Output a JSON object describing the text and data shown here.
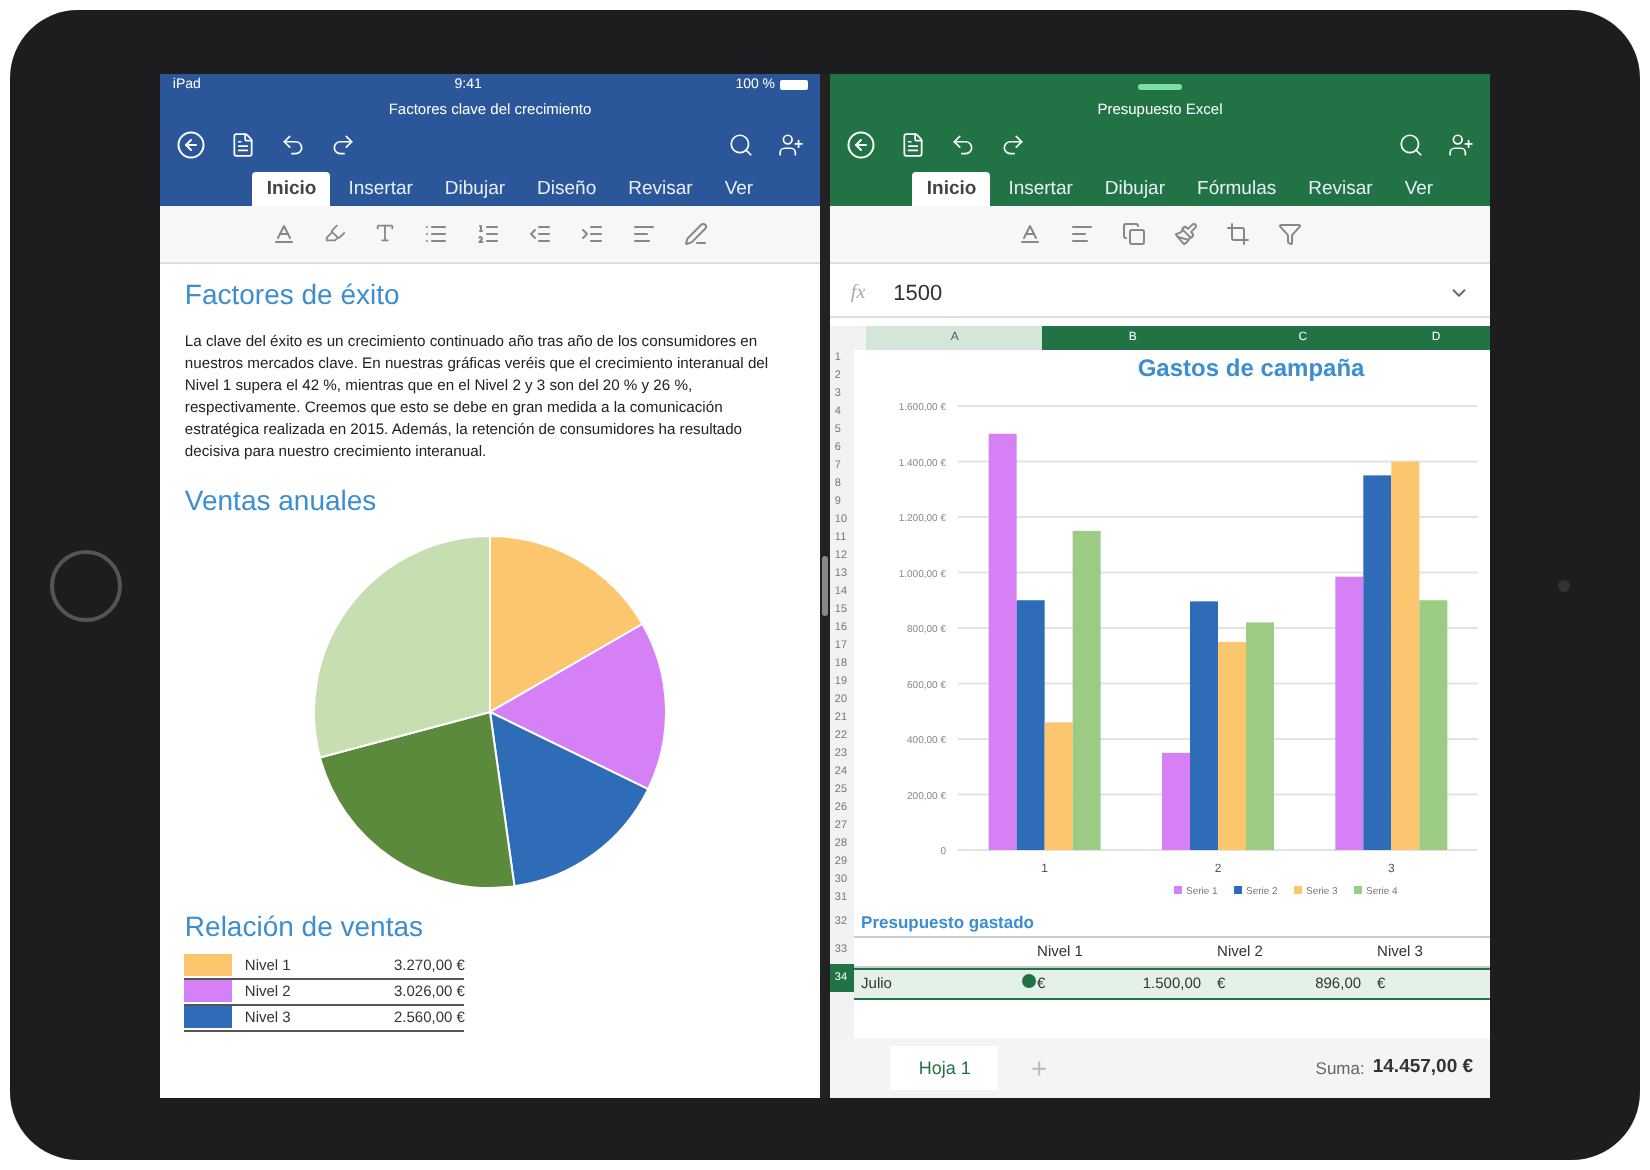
{
  "word": {
    "status": {
      "device": "iPad",
      "time": "9:41",
      "battery": "100 %"
    },
    "title": "Factores clave del crecimiento",
    "tabs": [
      {
        "label": "Inicio",
        "selected": true
      },
      {
        "label": "Insertar",
        "selected": false
      },
      {
        "label": "Dibujar",
        "selected": false
      },
      {
        "label": "Diseño",
        "selected": false
      },
      {
        "label": "Revisar",
        "selected": false
      },
      {
        "label": "Ver",
        "selected": false
      }
    ],
    "heading": "Factores de éxito",
    "paragraph": "La clave del éxito es un crecimiento continuado año tras año de los consumidores en nuestros mercados clave. En nuestras gráficas veréis que el crecimiento interanual del Nivel 1 supera el 42 %, mientras que en el Nivel 2 y 3 son del 20 % y 26 %, respectivamente. Creemos que esto se debe en gran medida a la comunicación estratégica realizada en 2015. Además, la retención de consumidores ha resultado decisiva para nuestro crecimiento interanual.",
    "chart_heading": "Ventas anuales",
    "table_heading": "Relación de ventas",
    "sales": [
      {
        "label": "Nivel 1",
        "value": "3.270,00 €",
        "color": "#fcc66e"
      },
      {
        "label": "Nivel 2",
        "value": "3.026,00 €",
        "color": "#d580f5"
      },
      {
        "label": "Nivel 3",
        "value": "2.560,00 €",
        "color": "#2e6cb8"
      }
    ]
  },
  "excel": {
    "title": "Presupuesto Excel",
    "tabs": [
      {
        "label": "Inicio",
        "selected": true
      },
      {
        "label": "Insertar",
        "selected": false
      },
      {
        "label": "Dibujar",
        "selected": false
      },
      {
        "label": "Fórmulas",
        "selected": false
      },
      {
        "label": "Revisar",
        "selected": false
      },
      {
        "label": "Ver",
        "selected": false
      }
    ],
    "formula_label": "fx",
    "formula": "1500",
    "columns": [
      {
        "label": "A",
        "selected": false
      },
      {
        "label": "B",
        "selected": true
      },
      {
        "label": "C",
        "selected": true
      },
      {
        "label": "D",
        "selected": true
      }
    ],
    "rows": [
      {
        "label": "1",
        "selected": false
      },
      {
        "label": "2",
        "selected": false
      },
      {
        "label": "3",
        "selected": false
      },
      {
        "label": "4",
        "selected": false
      },
      {
        "label": "5",
        "selected": false
      },
      {
        "label": "6",
        "selected": false
      },
      {
        "label": "7",
        "selected": false
      },
      {
        "label": "8",
        "selected": false
      },
      {
        "label": "9",
        "selected": false
      },
      {
        "label": "10",
        "selected": false
      },
      {
        "label": "11",
        "selected": false
      },
      {
        "label": "12",
        "selected": false
      },
      {
        "label": "13",
        "selected": false
      },
      {
        "label": "14",
        "selected": false
      },
      {
        "label": "15",
        "selected": false
      },
      {
        "label": "16",
        "selected": false
      },
      {
        "label": "17",
        "selected": false
      },
      {
        "label": "18",
        "selected": false
      },
      {
        "label": "19",
        "selected": false
      },
      {
        "label": "20",
        "selected": false
      },
      {
        "label": "21",
        "selected": false
      },
      {
        "label": "22",
        "selected": false
      },
      {
        "label": "23",
        "selected": false
      },
      {
        "label": "24",
        "selected": false
      },
      {
        "label": "25",
        "selected": false
      },
      {
        "label": "26",
        "selected": false
      },
      {
        "label": "27",
        "selected": false
      },
      {
        "label": "28",
        "selected": false
      },
      {
        "label": "29",
        "selected": false
      },
      {
        "label": "30",
        "selected": false
      },
      {
        "label": "31",
        "selected": false
      },
      {
        "label": "32",
        "selected": false
      },
      {
        "label": "33",
        "selected": false
      },
      {
        "label": "34",
        "selected": true
      }
    ],
    "chart": {
      "title": "Gastos de campaña",
      "chart_data": {
        "type": "bar",
        "categories": [
          "1",
          "2",
          "3"
        ],
        "series": [
          {
            "name": "Serie 1",
            "color": "#d580f5",
            "values": [
              1500,
              350,
              985
            ]
          },
          {
            "name": "Serie 2",
            "color": "#2e6cb8",
            "values": [
              900,
              896,
              1350
            ]
          },
          {
            "name": "Serie 3",
            "color": "#fcc66e",
            "values": [
              460,
              750,
              1400
            ]
          },
          {
            "name": "Serie 4",
            "color": "#9ccc84",
            "values": [
              1150,
              820,
              900
            ]
          }
        ],
        "ylim": [
          0,
          1600
        ],
        "grid": true,
        "legend": true,
        "yticks": [
          {
            "value": 0,
            "label": "0"
          },
          {
            "value": 200,
            "label": "200,00 €"
          },
          {
            "value": 400,
            "label": "400,00 €"
          },
          {
            "value": 600,
            "label": "600,00 €"
          },
          {
            "value": 800,
            "label": "800,00 €"
          },
          {
            "value": 1000,
            "label": "1.000,00 €"
          },
          {
            "value": 1200,
            "label": "1.200,00 €"
          },
          {
            "value": 1400,
            "label": "1.400,00 €"
          },
          {
            "value": 1600,
            "label": "1.600,00 €"
          }
        ]
      }
    },
    "section_title": "Presupuesto gastado",
    "header_cells": [
      "",
      "Nivel 1",
      "Nivel 2",
      "Nivel 3"
    ],
    "data_row": {
      "label": "Julio",
      "cells": [
        {
          "sign": "€",
          "amount": "1.500,00"
        },
        {
          "sign": "€",
          "amount": "896,00"
        },
        {
          "sign": "€"
        }
      ]
    },
    "sheet_tab": {
      "label": "Hoja 1",
      "selected": true
    },
    "add_sheet": "+",
    "sum_label": "Suma:",
    "sum_value": "14.457,00 €"
  }
}
